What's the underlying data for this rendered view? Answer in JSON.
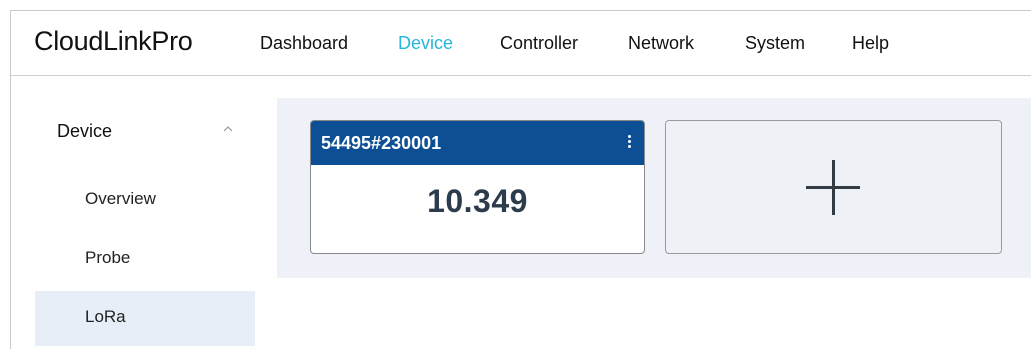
{
  "header": {
    "brand": "CloudLinkPro",
    "nav": [
      {
        "label": "Dashboard",
        "active": false
      },
      {
        "label": "Device",
        "active": true
      },
      {
        "label": "Controller",
        "active": false
      },
      {
        "label": "Network",
        "active": false
      },
      {
        "label": "System",
        "active": false
      },
      {
        "label": "Help",
        "active": false
      }
    ]
  },
  "sidebar": {
    "section_title": "Device",
    "section_icon": "chevron-up-icon",
    "items": [
      {
        "label": "Overview",
        "selected": false
      },
      {
        "label": "Probe",
        "selected": false
      },
      {
        "label": "LoRa",
        "selected": true
      }
    ]
  },
  "main": {
    "cards": [
      {
        "title": "54495#230001",
        "value": "10.349",
        "menu_icon": "kebab-menu-icon"
      }
    ],
    "add_card_icon": "plus-icon"
  },
  "colors": {
    "accent": "#29b6d8",
    "card_header": "#0d4f95",
    "selected_bg": "#e8eef8",
    "content_bg": "#eef2f8"
  }
}
